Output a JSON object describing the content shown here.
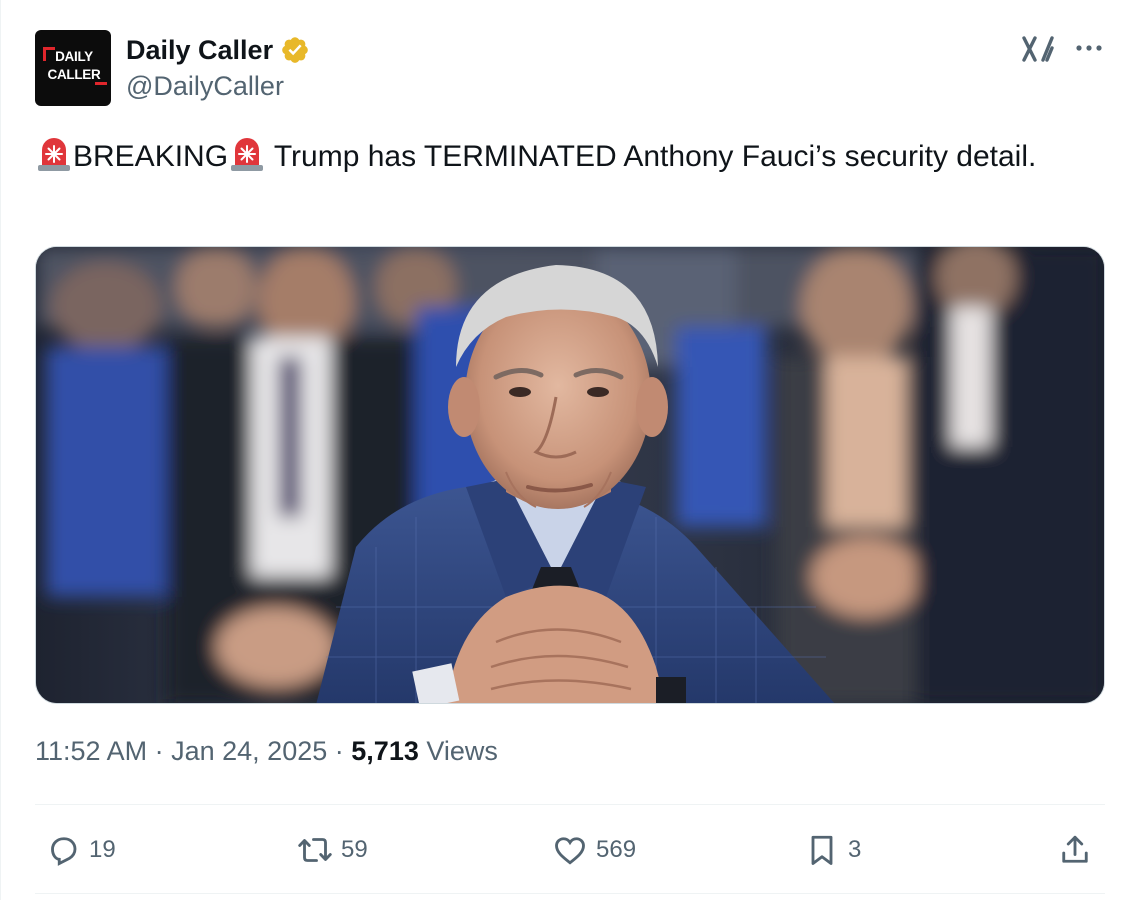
{
  "author": {
    "avatar_text_line1": "DAILY",
    "avatar_text_line2": "CALLER",
    "display_name": "Daily Caller",
    "handle": "@DailyCaller",
    "verified_color": "#e8b829"
  },
  "tweet": {
    "text_word1": "BREAKING",
    "text_rest": " Trump has TERMINATED Anthony Fauci’s security detail.",
    "icons": [
      "siren-icon",
      "siren-icon"
    ]
  },
  "media": {
    "alt": "Photo of Anthony Fauci seated in a blue suit with hands clasped, crowd blurred behind him"
  },
  "meta": {
    "time": "11:52 AM",
    "separator": "·",
    "date": "Jan 24, 2025",
    "views_count": "5,713",
    "views_label": "Views"
  },
  "actions": {
    "replies": "19",
    "reposts": "59",
    "likes": "569",
    "bookmarks": "3"
  },
  "colors": {
    "text_primary": "#0f1419",
    "text_secondary": "#536471",
    "border": "#eff3f4"
  }
}
